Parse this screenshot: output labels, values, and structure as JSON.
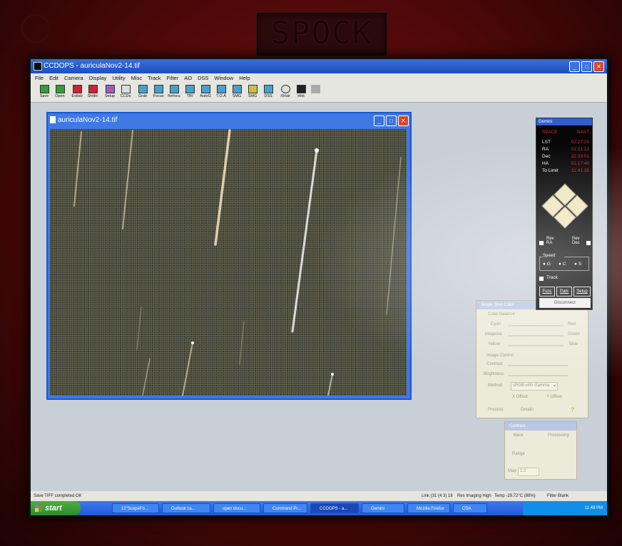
{
  "monitor_label": "SPOCK",
  "app": {
    "title": "CCDOPS - auriculaNov2-14.tif",
    "menu": [
      "File",
      "Edit",
      "Camera",
      "Display",
      "Utility",
      "Misc",
      "Track",
      "Filter",
      "AO",
      "DSS",
      "Window",
      "Help"
    ],
    "toolbar": [
      "Save",
      "Open",
      "Estlab",
      "Shitlin",
      "Setup",
      "CCDs",
      "Grab",
      "Focus",
      "Refocu",
      "TBI",
      "AutoG",
      "T.O.A",
      "SMG",
      "SMG",
      "DSS",
      "XHair",
      "Hist"
    ]
  },
  "image_window": {
    "title": "auriculaNov2-14.tif"
  },
  "telescope_panel": {
    "title": "Gemini",
    "header_left": "SPACE",
    "header_right": "BAST",
    "rows": [
      {
        "label": "LST",
        "value": "02:27:29"
      },
      {
        "label": "RA",
        "value": "01:21:12"
      },
      {
        "label": "Dec",
        "value": "22:33:01"
      },
      {
        "label": "HA",
        "value": "01:17:40"
      },
      {
        "label": "To Limit",
        "value": "11:41:35"
      }
    ],
    "rev_ra": "Rev RA",
    "rev_dec": "Rev Dec",
    "speed_label": "Speed",
    "speed_options": [
      "G",
      "C",
      "S"
    ],
    "track_label": "Track",
    "buttons": [
      "Func",
      "Park",
      "Setup"
    ],
    "disconnect": "Disconnect"
  },
  "color_panel": {
    "title": "Single Shot Color",
    "color_balance": "Color Balance",
    "balance_rows": [
      {
        "left": "Cyan",
        "right": "Red"
      },
      {
        "left": "Magenta",
        "right": "Green"
      },
      {
        "left": "Yellow",
        "right": "Blue"
      }
    ],
    "image_control": "Image Control",
    "contrast": "Contrast",
    "brightness": "Brightness",
    "method_label": "Method",
    "method_value": "sRGB with Gamma",
    "x_offset": "X Offset",
    "y_offset": "Y Offset",
    "process": "Process",
    "details": "Details"
  },
  "contrast_panel": {
    "title": "Contrast",
    "back": "Back",
    "processing": "Processing",
    "range": "Range",
    "map_label": "Map",
    "map_value": "1:2"
  },
  "status": {
    "left": "Save TIFF completed OK",
    "link": "Link (31 (4 3) 18",
    "mode": "Res Imaging High",
    "temp": "Temp -29.72°C (88%)",
    "filter": "Filter Blank"
  },
  "taskbar": {
    "start": "start",
    "tasks": [
      "12\"ScopeFo...",
      "Outlook ca...",
      "open docu...",
      "Command Pr...",
      "CCDOPS - a...",
      "Gemini",
      "Mozilla Firefox",
      "CDA"
    ],
    "clock": "11:49 PM"
  },
  "colors": {
    "accent": "#2458d8",
    "red_value": "#e02020",
    "desktop": "#c9cfd7"
  }
}
